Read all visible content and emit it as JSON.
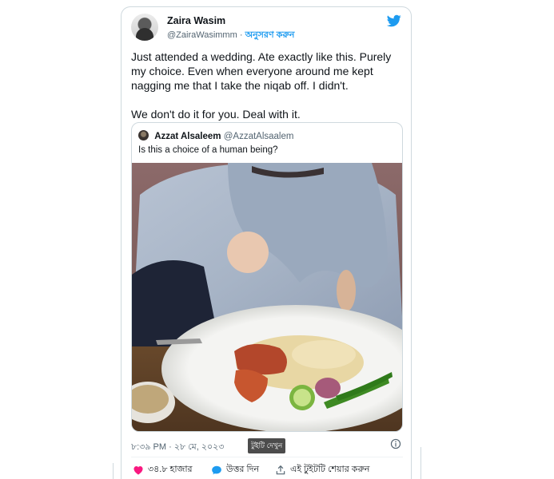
{
  "tweet": {
    "author_name": "Zaira Wasim",
    "author_handle": "@ZairaWasimmm",
    "separator": "·",
    "follow_label": "অনুসরণ করুন",
    "text_line1": "Just attended a wedding. Ate exactly like this. Purely my choice. Even when everyone around me kept nagging me that I take the niqab off. I didn't.",
    "text_line2": "We don't do it for you. Deal with it.",
    "timestamp": "৮:৩৯ PM · ২৮ মে, ২০২৩",
    "tooltip": "টুইটি দেখুন",
    "like_count": "৩৪.৮ হাজার",
    "reply_label": "উত্তর দিন",
    "share_label": "এই টুইটটি শেয়ার করুন"
  },
  "quoted": {
    "author_name": "Azzat Alsaleem",
    "author_handle": "@AzzatAlsaalem",
    "text": "Is this a choice of a human being?"
  },
  "icons": {
    "brand": "twitter-bird-icon",
    "info": "info-icon",
    "like": "heart-icon",
    "reply": "reply-bubble-icon",
    "share": "share-icon"
  },
  "colors": {
    "brand": "#1d9bf0",
    "heart": "#f91880",
    "muted": "#536471",
    "border": "#cfd9de"
  }
}
